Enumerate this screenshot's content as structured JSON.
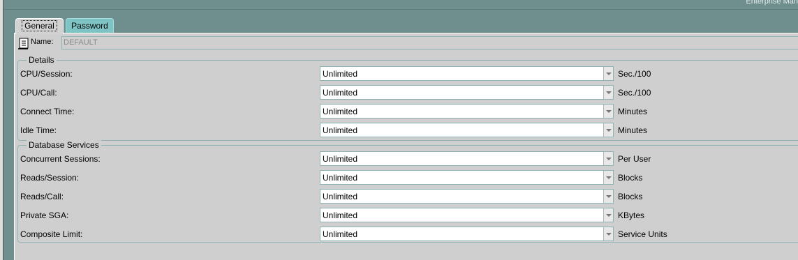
{
  "window": {
    "brand_text": "Enterprise Man"
  },
  "tabs": [
    {
      "label": "General",
      "selected": true
    },
    {
      "label": "Password",
      "selected": false
    }
  ],
  "name_field": {
    "label": "Name:",
    "value": "DEFAULT"
  },
  "details": {
    "title": "Details",
    "rows": [
      {
        "label": "CPU/Session:",
        "value": "Unlimited",
        "unit": "Sec./100"
      },
      {
        "label": "CPU/Call:",
        "value": "Unlimited",
        "unit": "Sec./100"
      },
      {
        "label": "Connect Time:",
        "value": "Unlimited",
        "unit": "Minutes"
      },
      {
        "label": "Idle Time:",
        "value": "Unlimited",
        "unit": "Minutes"
      }
    ]
  },
  "database_services": {
    "title": "Database Services",
    "rows": [
      {
        "label": "Concurrent Sessions:",
        "value": "Unlimited",
        "unit": "Per User"
      },
      {
        "label": "Reads/Session:",
        "value": "Unlimited",
        "unit": "Blocks"
      },
      {
        "label": "Reads/Call:",
        "value": "Unlimited",
        "unit": "Blocks"
      },
      {
        "label": "Private SGA:",
        "value": "Unlimited",
        "unit": "KBytes"
      },
      {
        "label": "Composite Limit:",
        "value": "Unlimited",
        "unit": "Service Units"
      }
    ]
  },
  "colors": {
    "frame": "#6f8f8f",
    "panel": "#cfcfcf",
    "active_tab": "#d2d2d2",
    "inactive_tab": "#7fc4c4",
    "border_accent": "#8fb3b3"
  },
  "icons": {
    "name_icon": "document-icon"
  }
}
